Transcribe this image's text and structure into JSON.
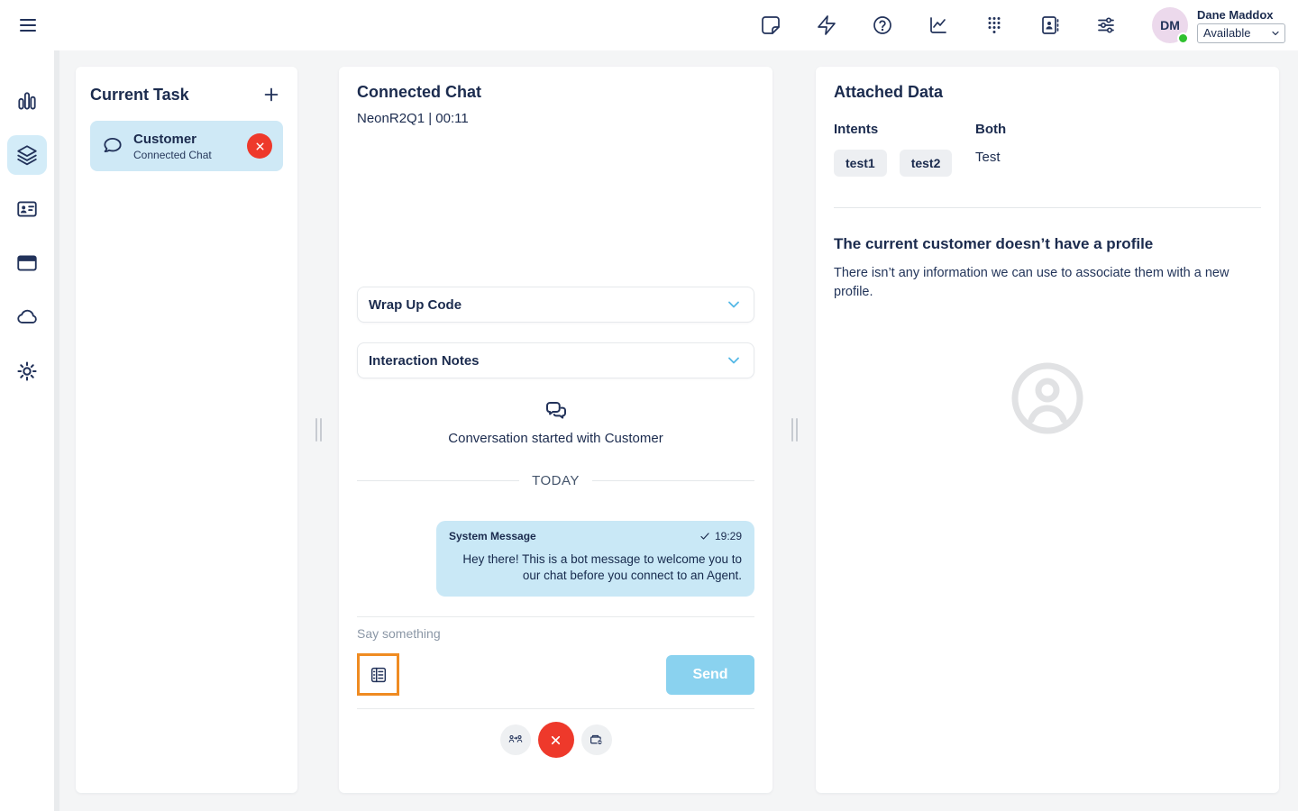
{
  "topbar": {
    "icons": [
      {
        "name": "notes-icon"
      },
      {
        "name": "interactions-lightning-icon"
      },
      {
        "name": "help-icon"
      },
      {
        "name": "performance-chart-icon"
      },
      {
        "name": "dialpad-icon"
      },
      {
        "name": "directory-icon"
      },
      {
        "name": "preferences-sliders-icon"
      }
    ],
    "user": {
      "initials": "DM",
      "name": "Dane Maddox",
      "status": "Available"
    }
  },
  "sidebar": {
    "items": [
      {
        "name": "activity-icon",
        "active": false
      },
      {
        "name": "interactions-layers-icon",
        "active": true
      },
      {
        "name": "contacts-card-icon",
        "active": false
      },
      {
        "name": "apps-window-icon",
        "active": false
      },
      {
        "name": "cloud-icon",
        "active": false
      },
      {
        "name": "settings-gear-icon",
        "active": false
      }
    ]
  },
  "task_panel": {
    "title": "Current Task",
    "task": {
      "name": "Customer",
      "type": "Connected Chat"
    }
  },
  "chat_panel": {
    "title": "Connected Chat",
    "session_info": "NeonR2Q1 | 00:11",
    "wrap_up_label": "Wrap Up Code",
    "interaction_notes_label": "Interaction Notes",
    "conversation_started": "Conversation started with Customer",
    "day_divider": "TODAY",
    "message": {
      "sender": "System Message",
      "time": "19:29",
      "text": "Hey there! This is a bot message to welcome you to our chat before you connect to an Agent."
    },
    "input_placeholder": "Say something",
    "send_label": "Send"
  },
  "data_panel": {
    "title": "Attached Data",
    "intents_label": "Intents",
    "intents": [
      "test1",
      "test2"
    ],
    "both_label": "Both",
    "both_value": "Test",
    "no_profile_title": "The current customer doesn’t have a profile",
    "no_profile_text": "There isn’t any information we can use to associate them with a new profile."
  },
  "colors": {
    "navy_text": "#1b2b4e",
    "selected_blue": "#d3ecf8",
    "task_card_blue": "#cfe9f6",
    "bubble_blue": "#c9e8f6",
    "send_blue": "#8ad2ef",
    "danger_red": "#ee392b",
    "highlight_orange": "#ef8b22",
    "chip_gray": "#edeff2",
    "page_bg": "#f4f5f6",
    "status_green": "#2fc12f",
    "chevron_blue": "#55b8e6"
  }
}
